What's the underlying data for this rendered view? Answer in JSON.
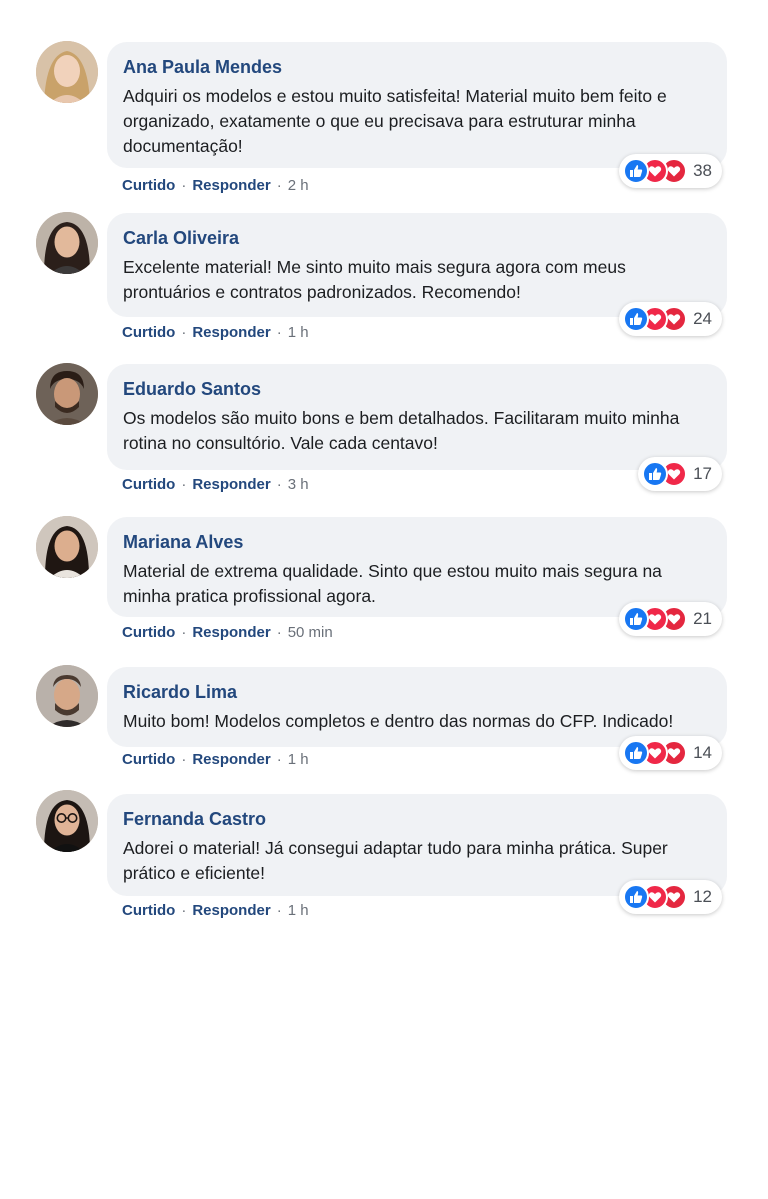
{
  "comments": [
    {
      "author": "Ana Paula Mendes",
      "text": "Adquiri os modelos e estou muito satisfeita!  Material muito bem feito e organizado, exatamente o que eu precisava para estruturar minha documentação!",
      "like_label": "Curtido",
      "reply_label": "Responder",
      "time": "2 h",
      "reaction_count": "38",
      "reactions": [
        "like",
        "love",
        "love"
      ]
    },
    {
      "author": "Carla Oliveira",
      "text": "Excelente material! Me sinto muito mais segura agora com meus prontuários e contratos padronizados. Recomendo!",
      "like_label": "Curtido",
      "reply_label": "Responder",
      "time": "1 h",
      "reaction_count": "24",
      "reactions": [
        "like",
        "love",
        "love"
      ]
    },
    {
      "author": "Eduardo Santos",
      "text": "Os modelos são muito bons e bem detalhados. Facilitaram muito minha rotina no consultório. Vale cada centavo!",
      "like_label": "Curtido",
      "reply_label": "Responder",
      "time": "3 h",
      "reaction_count": "17",
      "reactions": [
        "like",
        "love"
      ]
    },
    {
      "author": "Mariana Alves",
      "text": "Material de extrema qualidade. Sinto que estou muito mais segura na minha pratica profissional agora.",
      "like_label": "Curtido",
      "reply_label": "Responder",
      "time": "50 min",
      "reaction_count": "21",
      "reactions": [
        "like",
        "love",
        "love"
      ]
    },
    {
      "author": "Ricardo Lima",
      "text": "Muito bom! Modelos completos e dentro das normas do CFP. Indicado!",
      "like_label": "Curtido",
      "reply_label": "Responder",
      "time": "1 h",
      "reaction_count": "14",
      "reactions": [
        "like",
        "love",
        "love"
      ]
    },
    {
      "author": "Fernanda Castro",
      "text": "Adorei o material! Já consegui adaptar tudo para minha prática. Super prático e eficiente!",
      "like_label": "Curtido",
      "reply_label": "Responder",
      "time": "1 h",
      "reaction_count": "12",
      "reactions": [
        "like",
        "love",
        "love"
      ]
    }
  ],
  "separator": "·",
  "colors": {
    "author": "#23487d",
    "bubble": "#f0f2f5",
    "like": "#1877f2",
    "love": "#f02849"
  }
}
